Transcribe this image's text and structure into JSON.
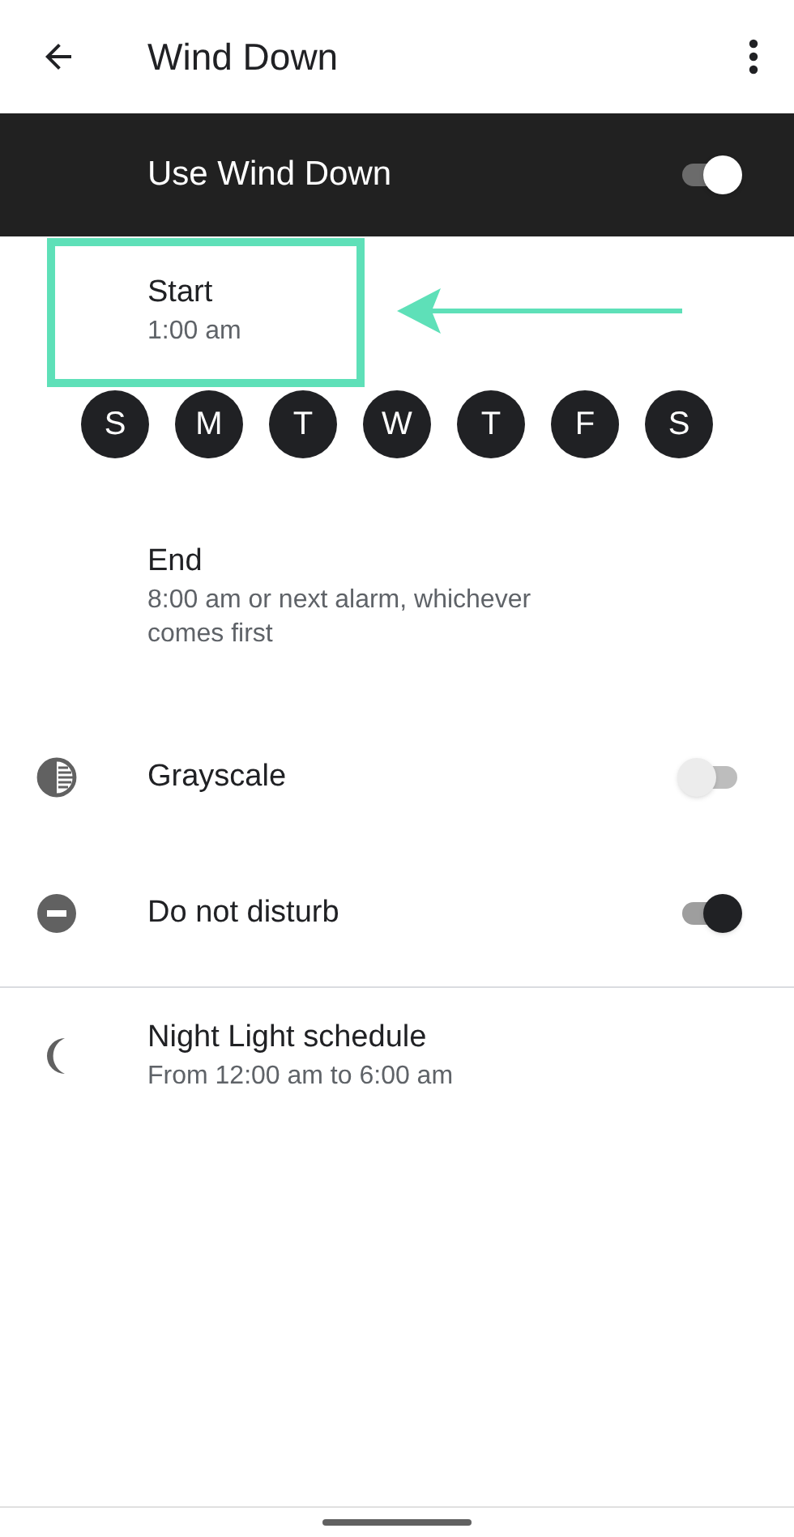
{
  "app_bar": {
    "title": "Wind Down"
  },
  "master_switch": {
    "label": "Use Wind Down",
    "on": true
  },
  "start": {
    "title": "Start",
    "subtitle": "1:00 am"
  },
  "days": [
    {
      "label": "S",
      "selected": true
    },
    {
      "label": "M",
      "selected": true
    },
    {
      "label": "T",
      "selected": true
    },
    {
      "label": "W",
      "selected": true
    },
    {
      "label": "T",
      "selected": true
    },
    {
      "label": "F",
      "selected": true
    },
    {
      "label": "S",
      "selected": true
    }
  ],
  "end": {
    "title": "End",
    "subtitle": "8:00 am or next alarm, whichever comes first"
  },
  "settings": [
    {
      "kind": "toggle",
      "title": "Grayscale",
      "on": false
    },
    {
      "kind": "toggle",
      "title": "Do not disturb",
      "on": true
    }
  ],
  "night_light": {
    "title": "Night Light schedule",
    "subtitle": "From 12:00 am to 6:00 am"
  }
}
